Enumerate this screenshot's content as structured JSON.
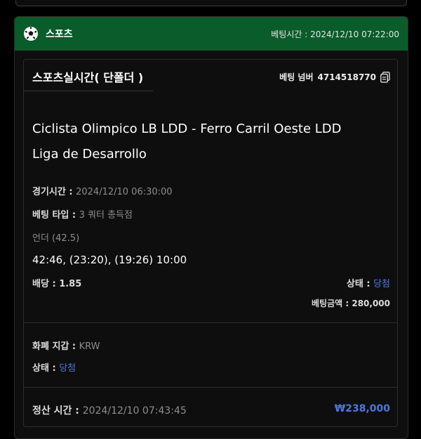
{
  "header": {
    "title": "스포츠",
    "bet_time_label": "베팅시간",
    "bet_time": "2024/12/10 07:22:00"
  },
  "bet": {
    "title": "스포츠실시간( 단폴더 )",
    "bet_number_label": "베팅 넘버",
    "bet_number": "4714518770",
    "match": "Ciclista Olimpico LB LDD - Ferro Carril Oeste LDD",
    "league": "Liga de Desarrollo",
    "game_time_label": "경기시간",
    "game_time": "2024/12/10 06:30:00",
    "bet_type_label": "베팅 타입",
    "bet_type": "3 쿼터 총득점",
    "pick": "언더 (42.5)",
    "score": "42:46, (23:20), (19:26) 10:00",
    "odds_label": "배당",
    "odds": "1.85",
    "status_label": "상태",
    "status": "당첨",
    "bet_amount_label": "베팅금액",
    "bet_amount": "280,000"
  },
  "payment": {
    "currency_label": "화폐 지갑",
    "currency": "KRW",
    "status_label": "상태",
    "status": "당첨"
  },
  "settlement": {
    "label": "정산 시간",
    "time": "2024/12/10 07:43:45",
    "amount": "₩238,000"
  },
  "colors": {
    "header_bg": "#0a5c2a",
    "win": "#4a78e0"
  },
  "icons": {
    "header": "soccer-ball-icon",
    "copy": "copy-icon"
  }
}
